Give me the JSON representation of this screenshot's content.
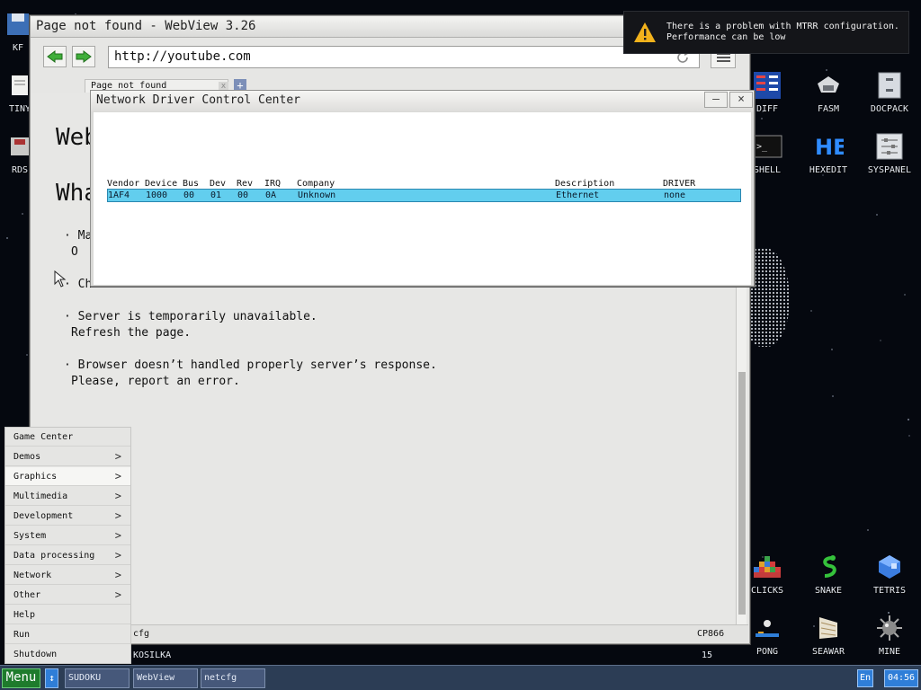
{
  "browser": {
    "title": "Page not found - WebView 3.26",
    "url": "http://youtube.com",
    "tab_label": "Page not found",
    "tab_close": "x",
    "tab_add": "+",
    "heading_fragment": "Web",
    "subheading_fragment": "Wha",
    "bullets": [
      {
        "line1": "Ma",
        "line2": "O"
      },
      {
        "line1": "Ch",
        "line2": ""
      },
      {
        "line1": "Server is temporarily unavailable.",
        "line2": "Refresh the page."
      },
      {
        "line1": "Browser doesn’t handled properly server’s response.",
        "line2": "Please, report an error."
      }
    ],
    "bullet_mark": "·",
    "status_left": "cfg",
    "status_right": "CP866"
  },
  "netcfg": {
    "title": "Network Driver Control Center",
    "minimize": "–",
    "close": "×",
    "columns": [
      "Vendor",
      "Device",
      "Bus",
      "Dev",
      "Rev",
      "IRQ",
      "Company",
      "Description",
      "DRIVER"
    ],
    "rows": [
      [
        "1AF4",
        "1000",
        "00",
        "01",
        "00",
        "0A",
        "Unknown",
        "Ethernet",
        "none"
      ]
    ]
  },
  "notification": {
    "line1": "There is a problem with MTRR configuration.",
    "line2": "Performance can be low"
  },
  "desktop_icons": [
    {
      "label": "DIFF",
      "icon": "diff-icon"
    },
    {
      "label": "FASM",
      "icon": "fasm-icon"
    },
    {
      "label": "DOCPACK",
      "icon": "docpack-icon"
    },
    {
      "label": "SHELL",
      "icon": "shell-icon"
    },
    {
      "label": "HEXEDIT",
      "icon": "hexedit-icon"
    },
    {
      "label": "SYSPANEL",
      "icon": "syspanel-icon"
    },
    {
      "label": "CLICKS",
      "icon": "clicks-icon"
    },
    {
      "label": "SNAKE",
      "icon": "snake-icon"
    },
    {
      "label": "TETRIS",
      "icon": "tetris-icon"
    },
    {
      "label": "PONG",
      "icon": "pong-icon"
    },
    {
      "label": "SEAWAR",
      "icon": "seawar-icon"
    },
    {
      "label": "MINE",
      "icon": "mine-icon"
    }
  ],
  "left_icon_fragments": [
    "KF",
    "TINY",
    "RDS"
  ],
  "shell_glyph": ">_",
  "hexedit_glyph": "HE",
  "desktop_footer": {
    "kosilka": "KOSILKA",
    "number": "15"
  },
  "start_menu": {
    "items": [
      {
        "label": "Game Center",
        "has_submenu": false
      },
      {
        "label": "Demos",
        "has_submenu": true
      },
      {
        "label": "Graphics",
        "has_submenu": true
      },
      {
        "label": "Multimedia",
        "has_submenu": true
      },
      {
        "label": "Development",
        "has_submenu": true
      },
      {
        "label": "System",
        "has_submenu": true
      },
      {
        "label": "Data processing",
        "has_submenu": true
      },
      {
        "label": "Network",
        "has_submenu": true
      },
      {
        "label": "Other",
        "has_submenu": true
      },
      {
        "label": "Help",
        "has_submenu": false
      },
      {
        "label": "Run",
        "has_submenu": false
      },
      {
        "label": "Shutdown",
        "has_submenu": false
      }
    ],
    "submenu_arrow": ">"
  },
  "taskbar": {
    "menu_label": "Menu",
    "arrow_label": "↕",
    "tasks": [
      "SUDOKU",
      "WebView",
      "netcfg"
    ],
    "lang": "En",
    "clock": "04:56"
  },
  "colors": {
    "selection": "#62ceee",
    "taskbar": "#2c3d55",
    "menu_button": "#1e7b2c",
    "accent_blue": "#2f7ed8"
  }
}
